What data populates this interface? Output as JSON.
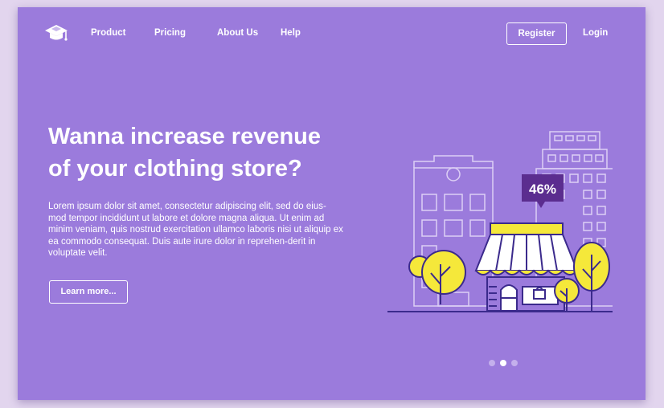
{
  "nav": {
    "logo_icon": "graduation-cap-icon",
    "links": [
      "Product",
      "Pricing",
      "About Us",
      "Help"
    ],
    "register_label": "Register",
    "login_label": "Login"
  },
  "hero": {
    "title_line1": "Wanna increase revenue",
    "title_line2": "of your clothing store?",
    "body": "Lorem ipsum dolor sit amet, consectetur adipiscing elit, sed do eius-mod tempor incididunt ut labore et dolore magna aliqua. Ut enim ad minim veniam, quis nostrud exercitation ullamco laboris nisi ut aliquip ex ea commodo consequat. Duis aute irure dolor in reprehen-derit in voluptate velit.",
    "cta_label": "Learn more..."
  },
  "illustration": {
    "badge_text": "46%",
    "icons": [
      "building-icon",
      "shop-icon",
      "tree-icon",
      "badge-icon"
    ]
  },
  "carousel": {
    "count": 3,
    "active_index": 1
  },
  "colors": {
    "background": "#9b7bdc",
    "outer": "#e2d5ee",
    "accent_yellow": "#f5e83a",
    "accent_dark_purple": "#5b2d8f",
    "line": "#3b2a8c"
  }
}
